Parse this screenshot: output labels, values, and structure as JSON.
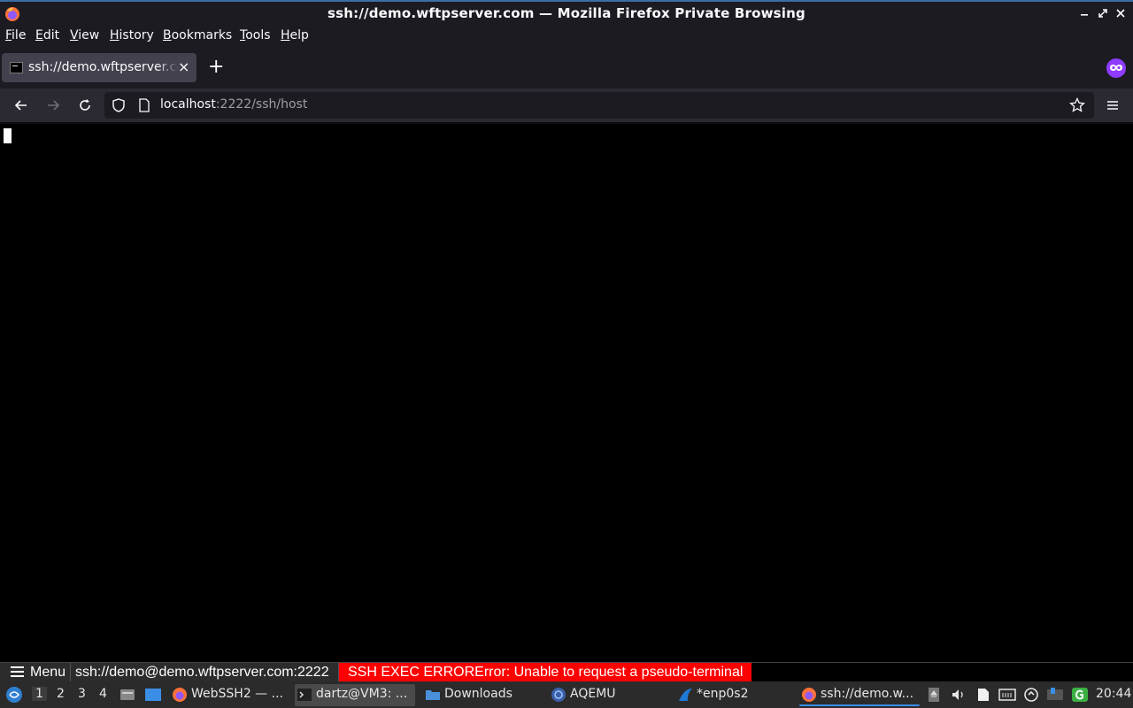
{
  "window": {
    "title": "ssh://demo.wftpserver.com — Mozilla Firefox Private Browsing"
  },
  "menubar": {
    "items": [
      {
        "label": "File",
        "key": "F",
        "rest": "ile"
      },
      {
        "label": "Edit",
        "key": "E",
        "rest": "dit"
      },
      {
        "label": "View",
        "key": "V",
        "rest": "iew"
      },
      {
        "label": "History",
        "key": "H",
        "rest": "istory"
      },
      {
        "label": "Bookmarks",
        "key": "B",
        "rest": "ookmarks"
      },
      {
        "label": "Tools",
        "key": "T",
        "rest": "ools"
      },
      {
        "label": "Help",
        "key": "H",
        "rest": "elp"
      }
    ]
  },
  "tabs": {
    "active_label": "ssh://demo.wftpserver.com",
    "close_glyph": "×",
    "new_tab_glyph": "+"
  },
  "navbar": {
    "url_host": "localhost",
    "url_rest": ":2222/ssh/host"
  },
  "statusbar": {
    "menu_label": "Menu",
    "host": "ssh://demo@demo.wftpserver.com:2222",
    "error": "SSH EXEC ERRORError: Unable to request a pseudo-terminal"
  },
  "taskbar": {
    "workspaces": [
      "1",
      "2",
      "3",
      "4"
    ],
    "tasks": [
      {
        "label": "WebSSH2 — ..."
      },
      {
        "label": "dartz@VM3: ..."
      },
      {
        "label": "Downloads"
      },
      {
        "label": "AQEMU"
      },
      {
        "label": "*enp0s2"
      },
      {
        "label": "ssh://demo.w..."
      }
    ],
    "clock": "20:44"
  },
  "colors": {
    "accent": "#3a6ea5",
    "error": "#ff0000",
    "private": "#8f3cff",
    "firefox_orange": "#ff7139"
  }
}
